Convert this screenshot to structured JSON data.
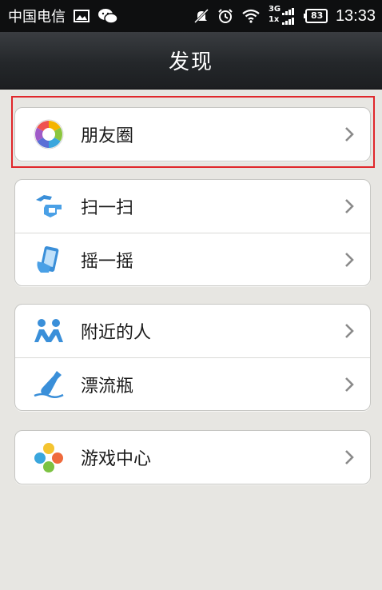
{
  "status_bar": {
    "carrier": "中国电信",
    "network": "3G",
    "network2": "1x",
    "battery": "83",
    "time": "13:33"
  },
  "header": {
    "title": "发现"
  },
  "groups": [
    {
      "items": [
        {
          "label": "朋友圈",
          "icon": "moments-icon"
        }
      ]
    },
    {
      "items": [
        {
          "label": "扫一扫",
          "icon": "scan-icon"
        },
        {
          "label": "摇一摇",
          "icon": "shake-icon"
        }
      ]
    },
    {
      "items": [
        {
          "label": "附近的人",
          "icon": "people-nearby-icon"
        },
        {
          "label": "漂流瓶",
          "icon": "drift-bottle-icon"
        }
      ]
    },
    {
      "items": [
        {
          "label": "游戏中心",
          "icon": "game-center-icon"
        }
      ]
    }
  ],
  "colors": {
    "status_bar_bg": "#0e0f10",
    "title_bar_bg": "#24272a",
    "page_bg": "#e7e6e2",
    "highlight": "#e0272b",
    "icon_blue": "#3a8fd9"
  }
}
